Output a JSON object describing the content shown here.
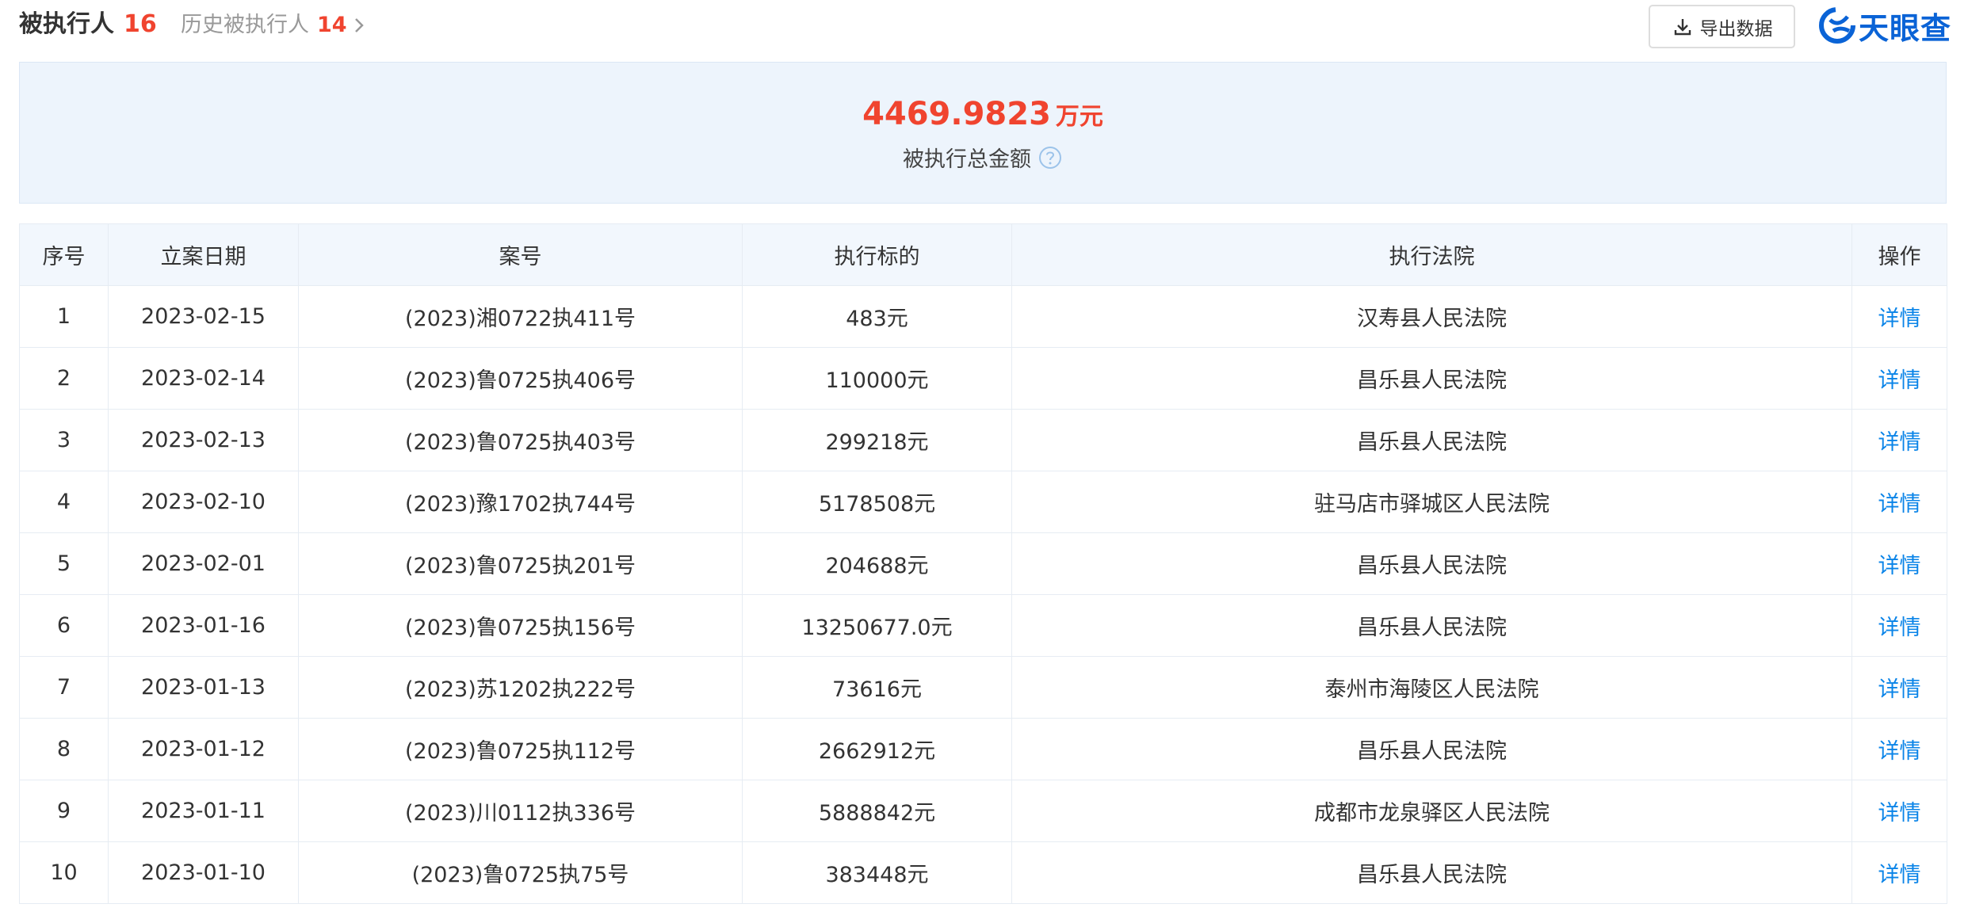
{
  "header": {
    "title": "被执行人",
    "count": "16",
    "history_label": "历史被执行人",
    "history_count": "14",
    "export_label": "导出数据",
    "logo_text": "天眼查"
  },
  "summary": {
    "amount": "4469.9823",
    "unit": "万元",
    "label": "被执行总金额"
  },
  "table": {
    "columns": [
      "序号",
      "立案日期",
      "案号",
      "执行标的",
      "执行法院",
      "操作"
    ],
    "rows": [
      [
        "1",
        "2023-02-15",
        "(2023)湘0722执411号",
        "483元",
        "汉寿县人民法院",
        "详情"
      ],
      [
        "2",
        "2023-02-14",
        "(2023)鲁0725执406号",
        "110000元",
        "昌乐县人民法院",
        "详情"
      ],
      [
        "3",
        "2023-02-13",
        "(2023)鲁0725执403号",
        "299218元",
        "昌乐县人民法院",
        "详情"
      ],
      [
        "4",
        "2023-02-10",
        "(2023)豫1702执744号",
        "5178508元",
        "驻马店市驿城区人民法院",
        "详情"
      ],
      [
        "5",
        "2023-02-01",
        "(2023)鲁0725执201号",
        "204688元",
        "昌乐县人民法院",
        "详情"
      ],
      [
        "6",
        "2023-01-16",
        "(2023)鲁0725执156号",
        "13250677.0元",
        "昌乐县人民法院",
        "详情"
      ],
      [
        "7",
        "2023-01-13",
        "(2023)苏1202执222号",
        "73616元",
        "泰州市海陵区人民法院",
        "详情"
      ],
      [
        "8",
        "2023-01-12",
        "(2023)鲁0725执112号",
        "2662912元",
        "昌乐县人民法院",
        "详情"
      ],
      [
        "9",
        "2023-01-11",
        "(2023)川0112执336号",
        "5888842元",
        "成都市龙泉驿区人民法院",
        "详情"
      ],
      [
        "10",
        "2023-01-10",
        "(2023)鲁0725执75号",
        "383448元",
        "昌乐县人民法院",
        "详情"
      ]
    ]
  },
  "colors": {
    "accent_red": "#f0442f",
    "link_blue": "#0a84e8",
    "brand_blue": "#0a63d6",
    "summary_bg": "#edf4fc"
  },
  "icons": {
    "export": "download-icon",
    "help": "question-circle-icon",
    "history": "chevron-right-icon",
    "logo": "tianyancha-logo-icon"
  }
}
